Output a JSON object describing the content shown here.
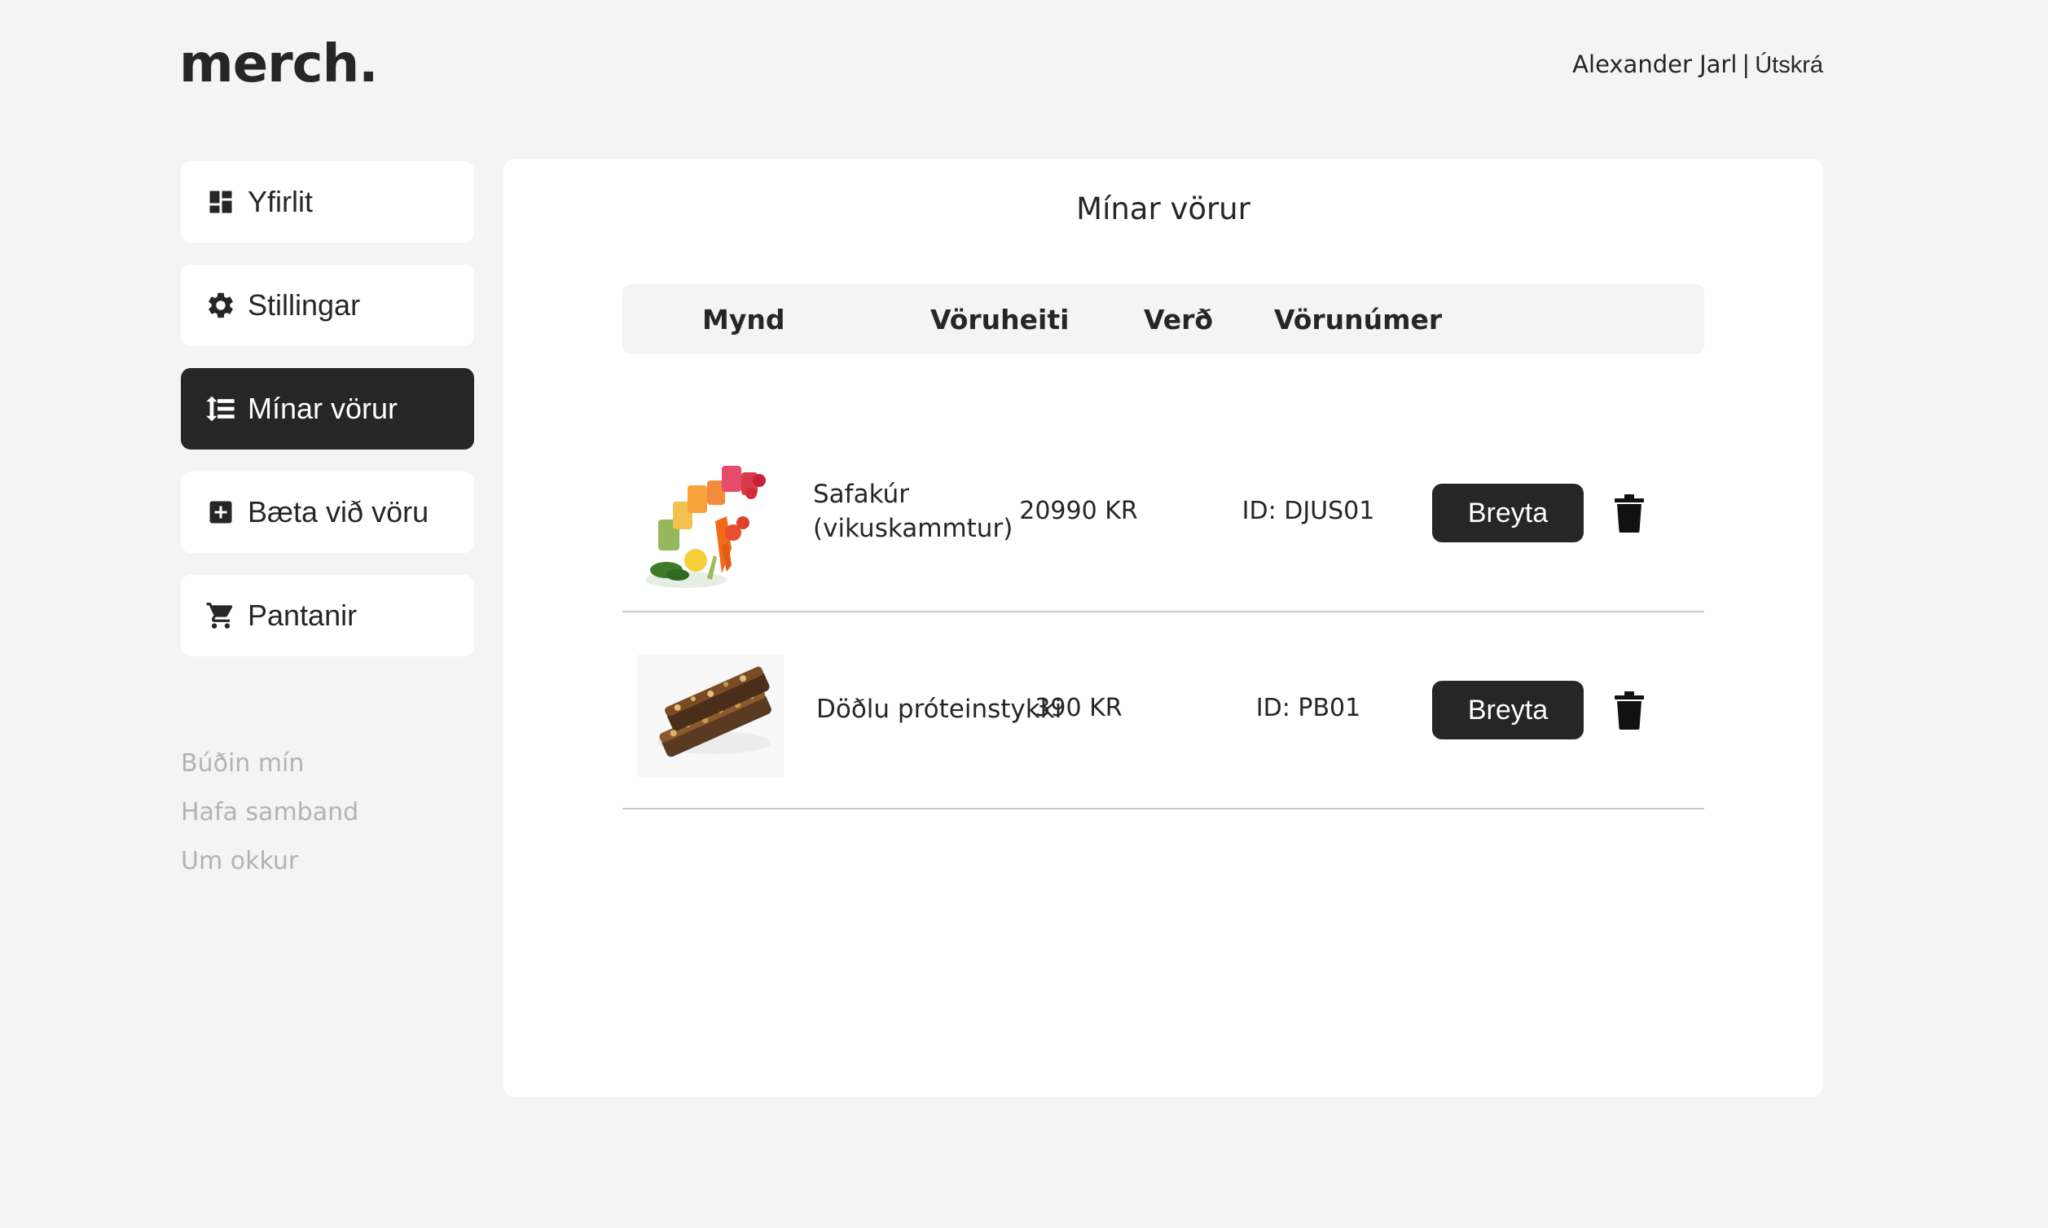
{
  "header": {
    "logo": "merch.",
    "user_name": "Alexander Jarl",
    "separator": "|",
    "logout": "Útskrá"
  },
  "sidebar": {
    "items": [
      {
        "label": "Yfirlit",
        "icon": "dashboard-icon"
      },
      {
        "label": "Stillingar",
        "icon": "gear-icon"
      },
      {
        "label": "Mínar vörur",
        "icon": "sort-list-icon",
        "active": true
      },
      {
        "label": "Bæta við vöru",
        "icon": "add-box-icon"
      },
      {
        "label": "Pantanir",
        "icon": "cart-icon"
      }
    ],
    "footer_links": [
      "Búðin mín",
      "Hafa samband",
      "Um okkur"
    ]
  },
  "main": {
    "title": "Mínar vörur",
    "columns": [
      "Mynd",
      "Vöruheiti",
      "Verð",
      "Vörunúmer"
    ],
    "products": [
      {
        "name_line1": "Safakúr",
        "name_line2": "(vikuskammtur)",
        "price": "20990 KR",
        "id": "ID: DJUS01",
        "edit_label": "Breyta",
        "image": "juice-cups-image"
      },
      {
        "name_line1": "Döðlu próteinstykki",
        "name_line2": "",
        "price": "390 KR",
        "id": "ID: PB01",
        "edit_label": "Breyta",
        "image": "protein-bars-image"
      }
    ]
  },
  "colors": {
    "background": "#f3f4f3",
    "dark": "#262626",
    "muted": "#b3b3b3",
    "divider": "#c8c8c8"
  }
}
